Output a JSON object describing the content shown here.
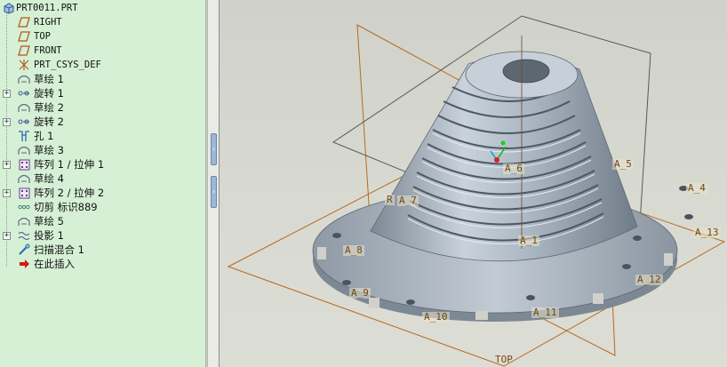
{
  "model_tree": {
    "items": [
      {
        "label": "PRT0011.PRT",
        "icon": "part-icon",
        "expander": "",
        "mono": true
      },
      {
        "label": "RIGHT",
        "icon": "datum-plane-icon",
        "expander": "",
        "mono": true
      },
      {
        "label": "TOP",
        "icon": "datum-plane-icon",
        "expander": "",
        "mono": true
      },
      {
        "label": "FRONT",
        "icon": "datum-plane-icon",
        "expander": "",
        "mono": true
      },
      {
        "label": "PRT_CSYS_DEF",
        "icon": "csys-icon",
        "expander": "",
        "mono": true
      },
      {
        "label": "草绘 1",
        "icon": "sketch-icon",
        "expander": ""
      },
      {
        "label": "旋转 1",
        "icon": "revolve-icon",
        "expander": "+"
      },
      {
        "label": "草绘 2",
        "icon": "sketch-icon",
        "expander": ""
      },
      {
        "label": "旋转 2",
        "icon": "revolve-icon",
        "expander": "+"
      },
      {
        "label": "孔 1",
        "icon": "hole-icon",
        "expander": ""
      },
      {
        "label": "草绘 3",
        "icon": "sketch-icon",
        "expander": ""
      },
      {
        "label": "阵列 1 / 拉伸 1",
        "icon": "pattern-icon",
        "expander": "+"
      },
      {
        "label": "草绘 4",
        "icon": "sketch-icon",
        "expander": ""
      },
      {
        "label": "阵列 2 / 拉伸 2",
        "icon": "pattern-icon",
        "expander": "+"
      },
      {
        "label": "切剪 标识889",
        "icon": "cut-icon",
        "expander": ""
      },
      {
        "label": "草绘 5",
        "icon": "sketch-icon",
        "expander": ""
      },
      {
        "label": "投影 1",
        "icon": "projection-icon",
        "expander": "+"
      },
      {
        "label": "扫描混合 1",
        "icon": "swept-blend-icon",
        "expander": ""
      },
      {
        "label": "在此插入",
        "icon": "insert-here-arrow-icon",
        "expander": ""
      }
    ]
  },
  "splitter": {
    "collapse_glyph": "‹",
    "expand_glyph": "›"
  },
  "viewport": {
    "datum_planes": [
      "TOP"
    ],
    "axis_labels": [
      "A_4",
      "A_5",
      "A_6",
      "A_7",
      "A_8",
      "A_9",
      "A_10",
      "A_11",
      "A_12",
      "A_13",
      "A_1"
    ],
    "fragment_label": "R"
  },
  "colors": {
    "tree_bg": "#d6f0d6",
    "datum_plane": "#b86a1e",
    "model_surface": "#aab6c2"
  }
}
